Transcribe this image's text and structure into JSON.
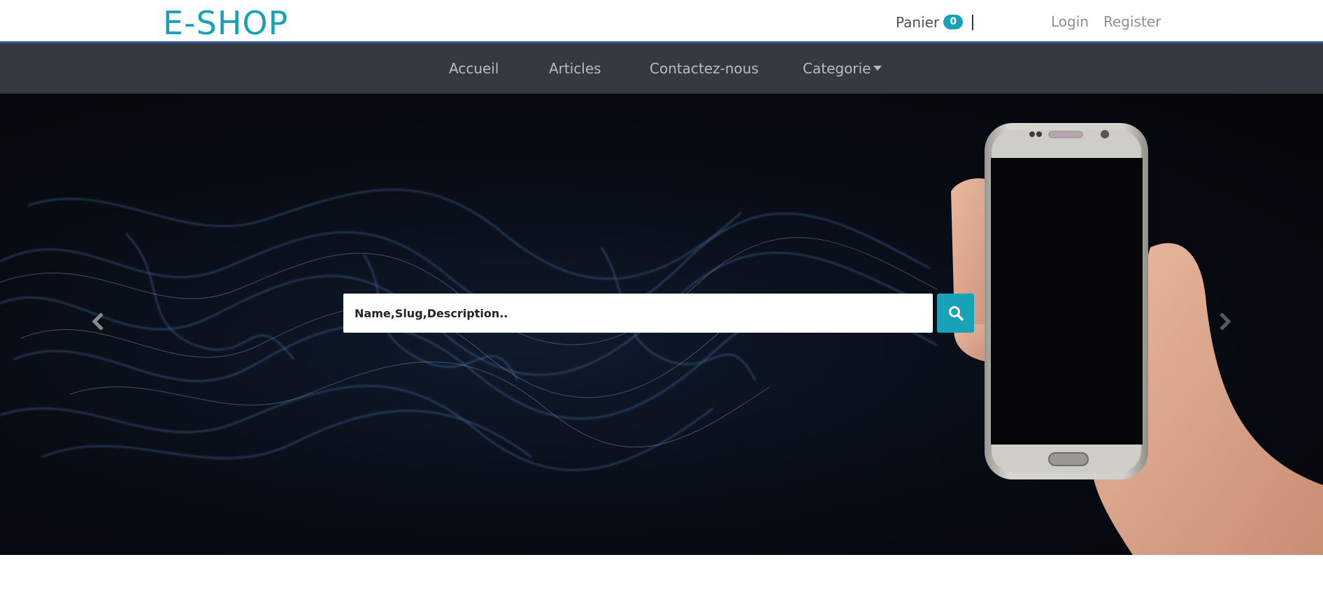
{
  "header": {
    "brand": "E-SHOP",
    "cart_label": "Panier",
    "cart_count": "0",
    "separator": "|",
    "login_label": "Login",
    "register_label": "Register"
  },
  "nav": {
    "items": [
      {
        "label": "Accueil"
      },
      {
        "label": "Articles"
      },
      {
        "label": "Contactez-nous"
      },
      {
        "label": "Categorie"
      }
    ]
  },
  "hero": {
    "search_placeholder": "Name,Slug,Description..",
    "search_icon": "search-icon",
    "prev_icon": "chevron-left-icon",
    "next_icon": "chevron-right-icon"
  },
  "colors": {
    "accent": "#17a2b8",
    "navbar_bg": "#343a40",
    "header_border": "#3b5aa6"
  }
}
